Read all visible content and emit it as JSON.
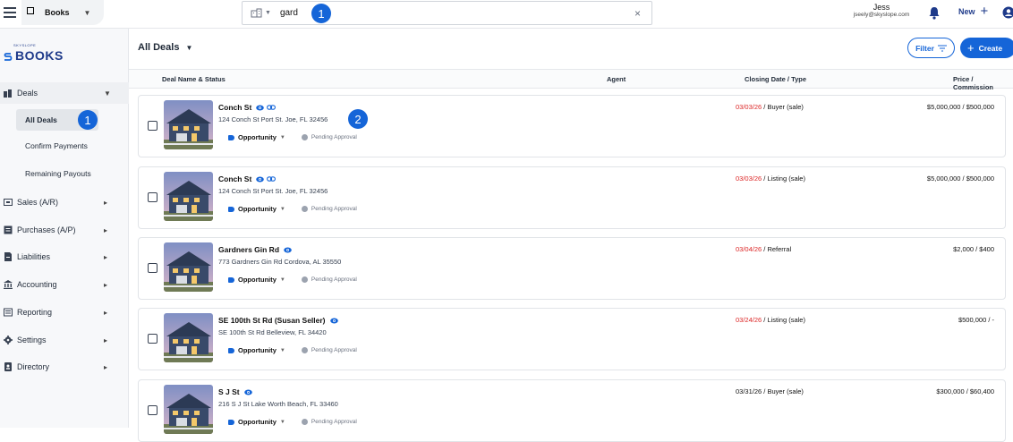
{
  "topbar": {
    "app_label": "Books",
    "search_value": "gard",
    "search_clear": "×",
    "user_name": "Jess",
    "user_email": "jseely@skyslope.com",
    "new_label": "New",
    "new_plus": "+"
  },
  "markers": {
    "search": "1",
    "sidebar": "1",
    "card": "2"
  },
  "logo": {
    "small": "SKYSLOPE",
    "text": "BOOKS"
  },
  "sidebar": {
    "deals": "Deals",
    "subs": [
      "All Deals",
      "Confirm Payments",
      "Remaining Payouts"
    ],
    "items": [
      "Sales (A/R)",
      "Purchases (A/P)",
      "Liabilities",
      "Accounting",
      "Reporting",
      "Settings",
      "Directory"
    ]
  },
  "main": {
    "title": "All Deals",
    "filter_label": "Filter",
    "create_label": "Create",
    "columns": {
      "name": "Deal Name & Status",
      "agent": "Agent",
      "closing": "Closing Date / Type",
      "price": "Price / Commission"
    }
  },
  "deals": [
    {
      "name": "Conch St",
      "address": "124 Conch St Port St. Joe, FL 32456",
      "stage": "Opportunity",
      "status": "Pending Approval",
      "date": "03/03/26",
      "type": " / Buyer (sale)",
      "price": "$5,000,000 / $500,000"
    },
    {
      "name": "Conch St",
      "address": "124 Conch St Port St. Joe, FL 32456",
      "stage": "Opportunity",
      "status": "Pending Approval",
      "date": "03/03/26",
      "type": " / Listing (sale)",
      "price": "$5,000,000 / $500,000"
    },
    {
      "name": "Gardners Gin Rd",
      "address": "773 Gardners Gin Rd Cordova, AL 35550",
      "stage": "Opportunity",
      "status": "Pending Approval",
      "date": "03/04/26",
      "type": " / Referral",
      "price": "$2,000 / $400"
    },
    {
      "name": "SE 100th St Rd (Susan Seller)",
      "address": "SE 100th St Rd Belleview, FL 34420",
      "stage": "Opportunity",
      "status": "Pending Approval",
      "date": "03/24/26",
      "type": " / Listing (sale)",
      "price": "$500,000 / -"
    },
    {
      "name": "S J St",
      "address": "216 S J St Lake Worth Beach, FL 33460",
      "stage": "Opportunity",
      "status": "Pending Approval",
      "date": "03/31/26",
      "type": " / Buyer (sale)",
      "price": "$300,000 / $60,400"
    }
  ],
  "colors": {
    "accent": "#1565d8",
    "date_red": "#dc2626",
    "brand": "#1e3a8a"
  },
  "icons": [
    "hamburger-icon",
    "building-icon",
    "bell-icon",
    "profile-icon",
    "eye-icon",
    "link-icon",
    "filter-icon"
  ]
}
